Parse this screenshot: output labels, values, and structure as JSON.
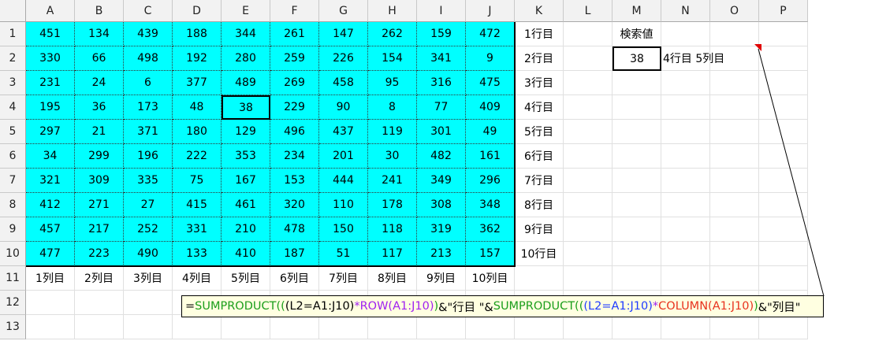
{
  "column_headers": [
    "A",
    "B",
    "C",
    "D",
    "E",
    "F",
    "G",
    "H",
    "I",
    "J",
    "K",
    "L",
    "M",
    "N",
    "O",
    "P"
  ],
  "row_headers": [
    "1",
    "2",
    "3",
    "4",
    "5",
    "6",
    "7",
    "8",
    "9",
    "10",
    "11",
    "12",
    "13"
  ],
  "data_grid": [
    [
      451,
      134,
      439,
      188,
      344,
      261,
      147,
      262,
      159,
      472
    ],
    [
      330,
      66,
      498,
      192,
      280,
      259,
      226,
      154,
      341,
      9
    ],
    [
      231,
      24,
      6,
      377,
      489,
      269,
      458,
      95,
      316,
      475
    ],
    [
      195,
      36,
      173,
      48,
      38,
      229,
      90,
      8,
      77,
      409
    ],
    [
      297,
      21,
      371,
      180,
      129,
      496,
      437,
      119,
      301,
      49
    ],
    [
      34,
      299,
      196,
      222,
      353,
      234,
      201,
      30,
      482,
      161
    ],
    [
      321,
      309,
      335,
      75,
      167,
      153,
      444,
      241,
      349,
      296
    ],
    [
      412,
      271,
      27,
      415,
      461,
      320,
      110,
      178,
      308,
      348
    ],
    [
      457,
      217,
      252,
      331,
      210,
      478,
      150,
      118,
      319,
      362
    ],
    [
      477,
      223,
      490,
      133,
      410,
      187,
      51,
      117,
      213,
      157
    ]
  ],
  "row_labels": [
    "1行目",
    "2行目",
    "3行目",
    "4行目",
    "5行目",
    "6行目",
    "7行目",
    "8行目",
    "9行目",
    "10行目"
  ],
  "column_labels": [
    "1列目",
    "2列目",
    "3列目",
    "4列目",
    "5列目",
    "6列目",
    "7列目",
    "8列目",
    "9列目",
    "10列目"
  ],
  "search": {
    "label": "検索値",
    "value": "38",
    "result": "4行目 5列目"
  },
  "highlighted_cell": {
    "row": 4,
    "column": 5
  },
  "formula": {
    "text": "=SUMPRODUCT((L2=A1:J10)*ROW(A1:J10))&\"行目 \"&SUMPRODUCT((L2=A1:J10)*COLUMN(A1:J10))&\"列目\"",
    "segments": [
      {
        "text": "=",
        "color": "#000000"
      },
      {
        "text": "SUMPRODUCT(",
        "color": "#1b9e1b"
      },
      {
        "text": "(",
        "color": "#1b9e1b"
      },
      {
        "text": "(L2=A1:J10)",
        "color": "#000000"
      },
      {
        "text": "*",
        "color": "#a020f0"
      },
      {
        "text": "ROW(A1:J10)",
        "color": "#a020f0"
      },
      {
        "text": ")",
        "color": "#1b9e1b"
      },
      {
        "text": "&\"行目 \"&",
        "color": "#000000"
      },
      {
        "text": "SUMPRODUCT(",
        "color": "#1b9e1b"
      },
      {
        "text": "(",
        "color": "#1b9e1b"
      },
      {
        "text": "(L2=A1:J10)",
        "color": "#1f3bff"
      },
      {
        "text": "*",
        "color": "#a020f0"
      },
      {
        "text": "COLUMN(A1:J10)",
        "color": "#e8321e"
      },
      {
        "text": ")",
        "color": "#1b9e1b"
      },
      {
        "text": "&\"列目\"",
        "color": "#000000"
      }
    ]
  },
  "colors": {
    "data_fill": "#00ffff",
    "comment_fill": "#ffffe1",
    "comment_indicator": "#e00000"
  }
}
